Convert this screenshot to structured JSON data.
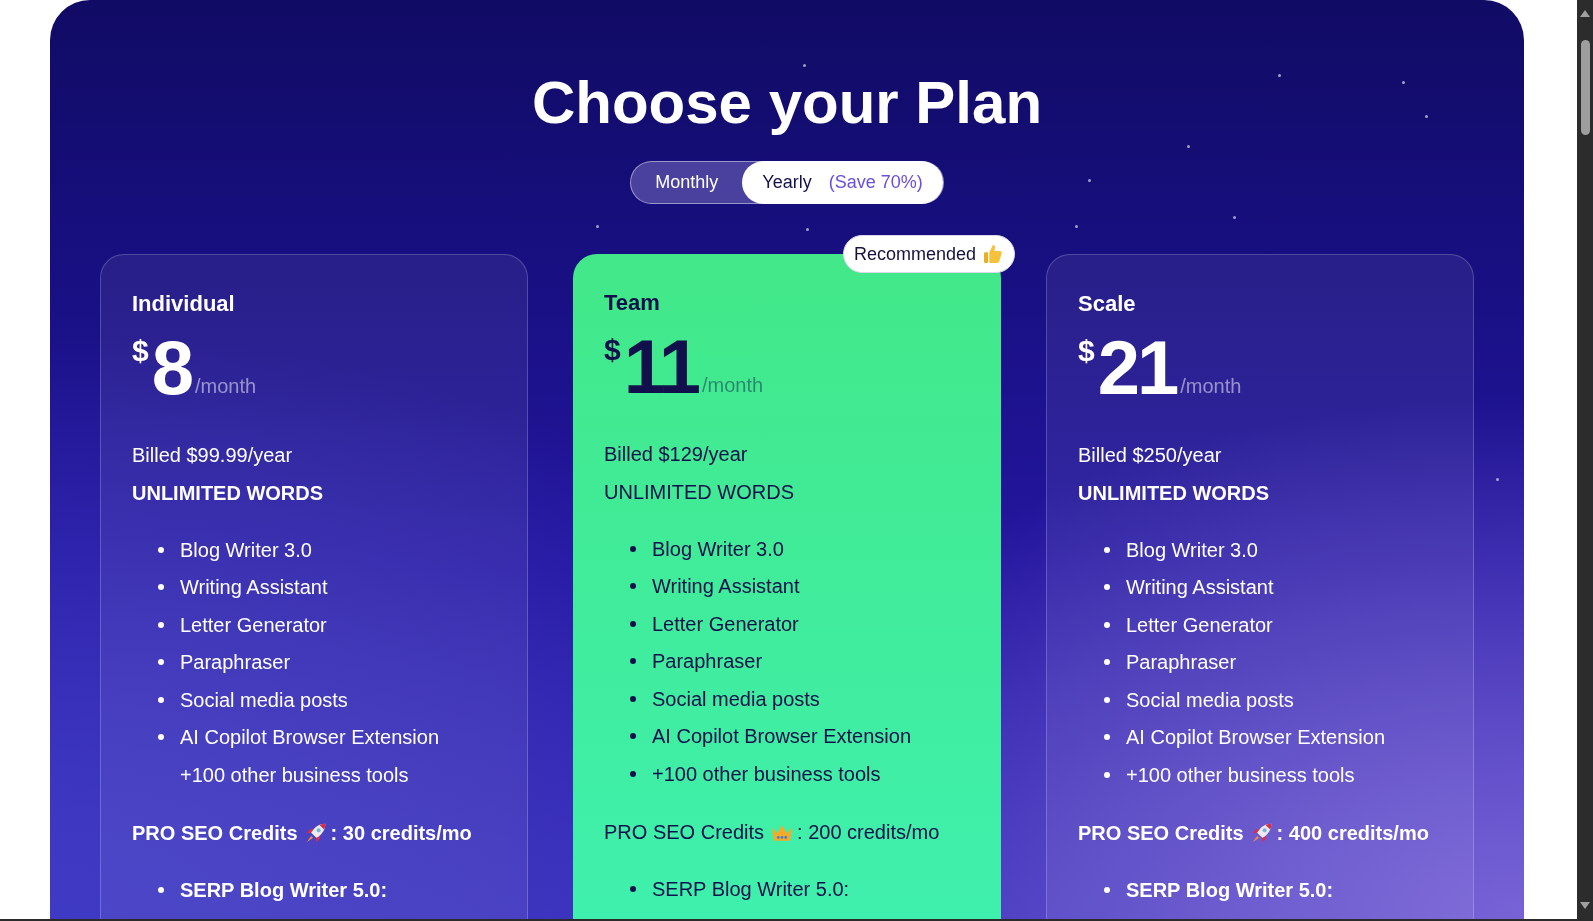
{
  "page": {
    "title": "Choose your Plan"
  },
  "billing_toggle": {
    "options": [
      {
        "label": "Monthly",
        "selected": false
      },
      {
        "label": "Yearly",
        "note": "(Save 70%)",
        "selected": true
      }
    ]
  },
  "plans": [
    {
      "name": "Individual",
      "highlighted": false,
      "currency": "$",
      "price": "8",
      "period": "/month",
      "billed": "Billed $99.99/year",
      "words": "UNLIMITED WORDS",
      "features": [
        {
          "text": "Blog Writer 3.0",
          "bullet": true
        },
        {
          "text": "Writing Assistant",
          "bullet": true
        },
        {
          "text": "Letter Generator",
          "bullet": true
        },
        {
          "text": "Paraphraser",
          "bullet": true
        },
        {
          "text": "Social media posts",
          "bullet": true
        },
        {
          "text": "AI Copilot Browser Extension",
          "bullet": true
        },
        {
          "text": "+100 other business tools",
          "bullet": false
        }
      ],
      "credits": {
        "kind": "rocket",
        "label": "PRO SEO Credits",
        "value": ": 30 credits/mo"
      },
      "seo_features": [
        "SERP Blog Writer 5.0:"
      ]
    },
    {
      "name": "Team",
      "highlighted": true,
      "badge": {
        "label": "Recommended"
      },
      "currency": "$",
      "price": "11",
      "period": "/month",
      "billed": "Billed $129/year",
      "words": "UNLIMITED WORDS",
      "features": [
        {
          "text": "Blog Writer 3.0",
          "bullet": true
        },
        {
          "text": "Writing Assistant",
          "bullet": true
        },
        {
          "text": "Letter Generator",
          "bullet": true
        },
        {
          "text": "Paraphraser",
          "bullet": true
        },
        {
          "text": "Social media posts",
          "bullet": true
        },
        {
          "text": "AI Copilot Browser Extension",
          "bullet": true
        },
        {
          "text": "+100 other business tools",
          "bullet": true
        }
      ],
      "credits": {
        "kind": "crown",
        "label": "PRO SEO Credits",
        "value": ": 200 credits/mo"
      },
      "seo_features": [
        "SERP Blog Writer 5.0:"
      ]
    },
    {
      "name": "Scale",
      "highlighted": false,
      "currency": "$",
      "price": "21",
      "period": "/month",
      "billed": "Billed $250/year",
      "words": "UNLIMITED WORDS",
      "features": [
        {
          "text": "Blog Writer 3.0",
          "bullet": true
        },
        {
          "text": "Writing Assistant",
          "bullet": true
        },
        {
          "text": "Letter Generator",
          "bullet": true
        },
        {
          "text": "Paraphraser",
          "bullet": true
        },
        {
          "text": "Social media posts",
          "bullet": true
        },
        {
          "text": "AI Copilot Browser Extension",
          "bullet": true
        },
        {
          "text": "+100 other business tools",
          "bullet": true
        }
      ],
      "credits": {
        "kind": "rocket",
        "label": "PRO SEO Credits",
        "value": ": 400 credits/mo"
      },
      "seo_features": [
        "SERP Blog Writer 5.0:"
      ]
    }
  ]
}
